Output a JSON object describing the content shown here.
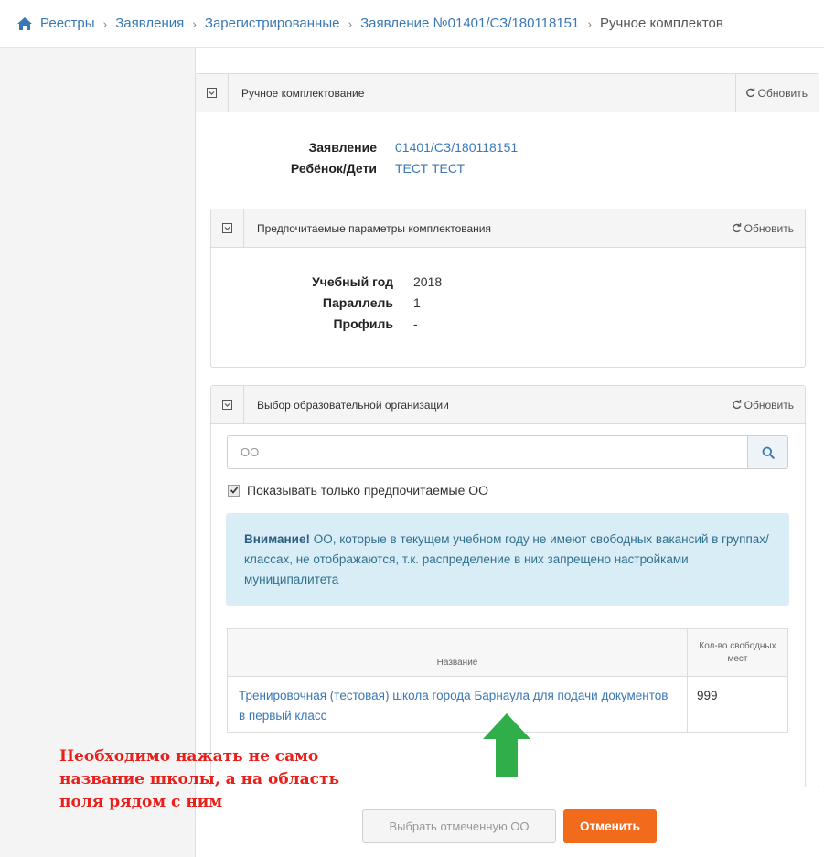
{
  "breadcrumb": {
    "items": [
      "Реестры",
      "Заявления",
      "Зарегистрированные",
      "Заявление №01401/СЗ/180118151",
      "Ручное комплектов"
    ]
  },
  "main_panel": {
    "title": "Ручное комплектование",
    "refresh_label": "Обновить",
    "application_label": "Заявление",
    "application_value": "01401/СЗ/180118151",
    "child_label": "Ребёнок/Дети",
    "child_value": "ТЕСТ ТЕСТ"
  },
  "preferred_panel": {
    "title": "Предпочитаемые параметры комплектования",
    "refresh_label": "Обновить",
    "year_label": "Учебный год",
    "year_value": "2018",
    "parallel_label": "Параллель",
    "parallel_value": "1",
    "profile_label": "Профиль",
    "profile_value": "-"
  },
  "org_panel": {
    "title": "Выбор образовательной организации",
    "refresh_label": "Обновить",
    "search_value": "ОО",
    "checkbox_label": "Показывать только предпочитаемые ОО",
    "checkbox_checked": true,
    "alert_bold": "Внимание!",
    "alert_text": " ОО, которые в текущем учебном году не имеют свободных вакансий в группах/классах, не отображаются, т.к. распределение в них запрещено настройками муниципалитета",
    "table": {
      "col_name": "Название",
      "col_places": "Кол-во свободных мест",
      "rows": [
        {
          "name": "Тренировочная (тестовая) школа города Барнаула для подачи документов в первый класс",
          "places": "999"
        }
      ]
    }
  },
  "actions": {
    "select_label": "Выбрать отмеченную ОО",
    "cancel_label": "Отменить"
  },
  "annotation": {
    "line1": "Необходимо нажать не само",
    "line2": "название школы, а на область",
    "line3": "поля рядом с ним"
  },
  "colors": {
    "link": "#3a78b5",
    "alert_bg": "#d9edf7",
    "cancel_bg": "#f26a1b",
    "annotation": "#e8201c",
    "arrow": "#2fae4a"
  },
  "icons": [
    "home-icon",
    "collapse-icon",
    "refresh-icon",
    "search-icon",
    "check-icon",
    "arrow-up-icon"
  ]
}
